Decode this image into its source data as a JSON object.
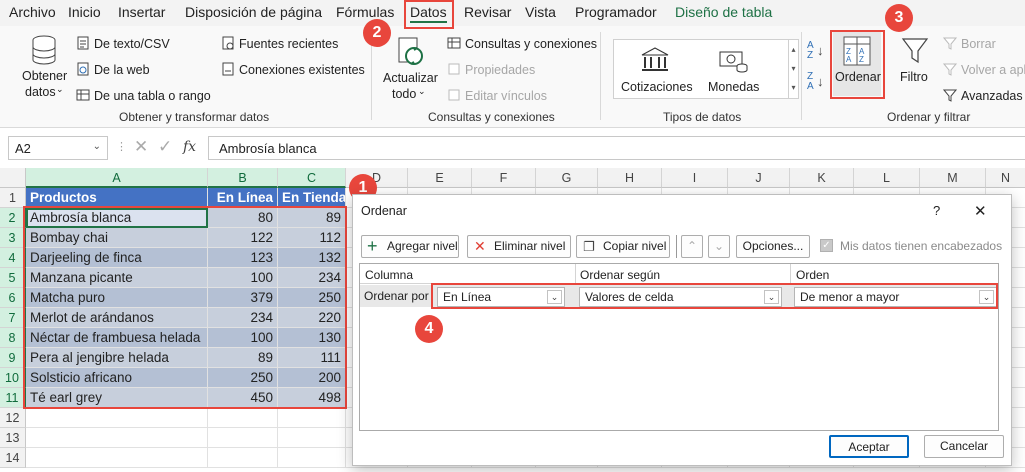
{
  "tabs": [
    "Archivo",
    "Inicio",
    "Insertar",
    "Disposición de página",
    "Fórmulas",
    "Datos",
    "Revisar",
    "Vista",
    "Programador",
    "Diseño de tabla"
  ],
  "ribbon": {
    "obtener_datos": "Obtener datos",
    "obtener_datos_line1": "Obtener",
    "obtener_datos_line2": "datos",
    "de_texto": "De texto/CSV",
    "de_web": "De la web",
    "de_tabla": "De una tabla o rango",
    "fuentes": "Fuentes recientes",
    "conexiones_existentes": "Conexiones existentes",
    "group1": "Obtener y transformar datos",
    "actualizar_line1": "Actualizar",
    "actualizar_line2": "todo",
    "consultas": "Consultas y conexiones",
    "propiedades": "Propiedades",
    "editar_vinculos": "Editar vínculos",
    "group2": "Consultas y conexiones",
    "cotizaciones": "Cotizaciones",
    "monedas": "Monedas",
    "group3": "Tipos de datos",
    "ordenar": "Ordenar",
    "filtro": "Filtro",
    "borrar": "Borrar",
    "volver": "Volver a apli",
    "avanzadas": "Avanzadas",
    "group4": "Ordenar y filtrar"
  },
  "formula_bar": {
    "name_box": "A2",
    "fx": "fx",
    "content": "Ambrosía blanca"
  },
  "columns": [
    "A",
    "B",
    "C",
    "D",
    "E",
    "F",
    "G",
    "H",
    "I",
    "J",
    "K",
    "L",
    "M",
    "N"
  ],
  "rows": [
    "1",
    "2",
    "3",
    "4",
    "5",
    "6",
    "7",
    "8",
    "9",
    "10",
    "11",
    "12",
    "13",
    "14"
  ],
  "table": {
    "headers": [
      "Productos",
      "En Línea",
      "En Tienda"
    ],
    "data": [
      [
        "Ambrosía blanca",
        "80",
        "89"
      ],
      [
        "Bombay chai",
        "122",
        "112"
      ],
      [
        "Darjeeling de finca",
        "123",
        "132"
      ],
      [
        "Manzana picante",
        "100",
        "234"
      ],
      [
        "Matcha puro",
        "379",
        "250"
      ],
      [
        "Merlot de arándanos",
        "234",
        "220"
      ],
      [
        "Néctar de frambuesa helada",
        "100",
        "130"
      ],
      [
        "Pera al jengibre helada",
        "89",
        "111"
      ],
      [
        "Solsticio africano",
        "250",
        "200"
      ],
      [
        "Té earl grey",
        "450",
        "498"
      ]
    ]
  },
  "callouts": [
    "1",
    "2",
    "3",
    "4"
  ],
  "dialog": {
    "title": "Ordenar",
    "help": "?",
    "close": "✕",
    "add_level": "Agregar nivel",
    "delete_level": "Eliminar nivel",
    "copy_level": "Copiar nivel",
    "options": "Opciones...",
    "headers_checkbox": "Mis datos tienen encabezados",
    "col_header": "Columna",
    "sort_on_header": "Ordenar según",
    "order_header": "Orden",
    "row_label": "Ordenar por",
    "column_value": "En Línea",
    "sort_on_value": "Valores de celda",
    "order_value": "De menor a mayor",
    "accept": "Aceptar",
    "cancel": "Cancelar"
  },
  "colors": {
    "accent": "#217346",
    "callout": "#e8463c",
    "table_header": "#4472c4",
    "row_band": "#b4c0d4"
  }
}
